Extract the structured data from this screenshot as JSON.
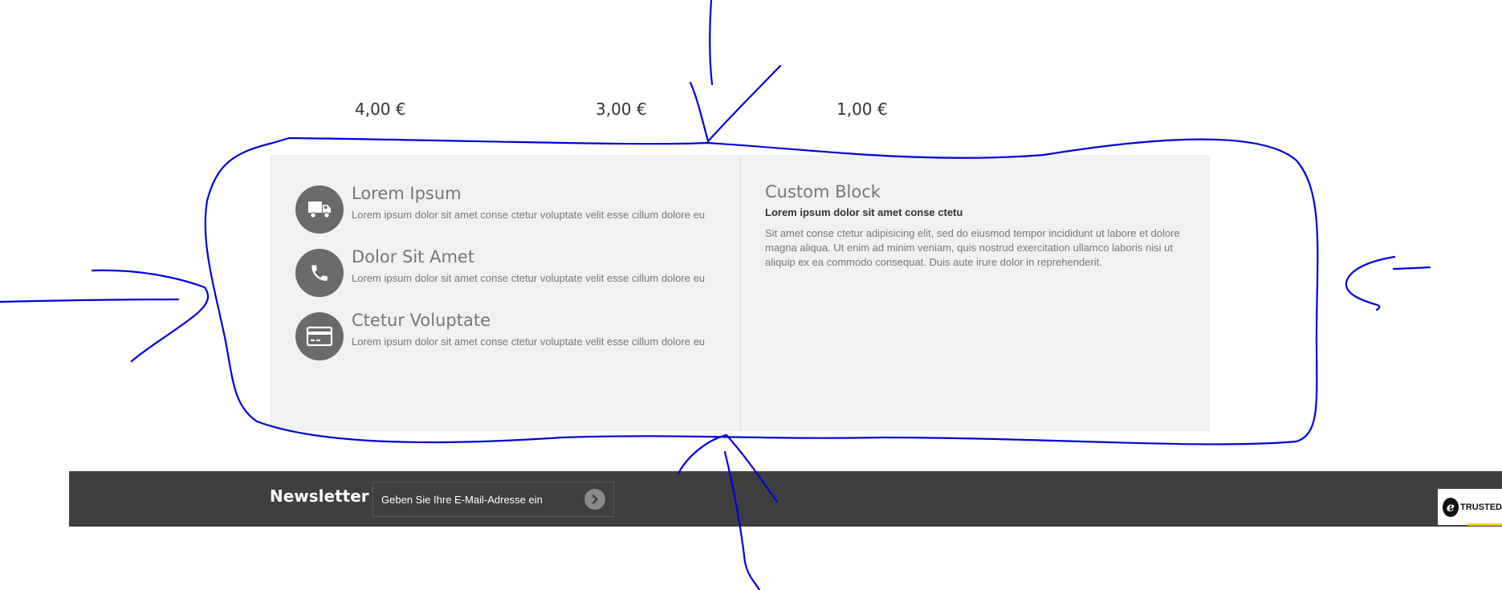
{
  "prices": [
    "4,00 €",
    "3,00 €",
    "1,00 €"
  ],
  "services": [
    {
      "title": "Lorem Ipsum",
      "text": "Lorem ipsum dolor sit amet conse ctetur voluptate velit esse cillum dolore eu",
      "icon": "truck-icon"
    },
    {
      "title": "Dolor Sit Amet",
      "text": "Lorem ipsum dolor sit amet conse ctetur voluptate velit esse cillum dolore eu",
      "icon": "phone-icon"
    },
    {
      "title": "Ctetur Voluptate",
      "text": "Lorem ipsum dolor sit amet conse ctetur voluptate velit esse cillum dolore eu",
      "icon": "credit-card-icon"
    }
  ],
  "custom_block": {
    "title": "Custom Block",
    "subtitle": "Lorem ipsum dolor sit amet conse ctetu",
    "text": "Sit amet conse ctetur adipisicing elit, sed do eiusmod tempor incididunt ut labore et dolore magna aliqua. Ut enim ad minim veniam, quis nostrud exercitation ullamco laboris nisi ut aliquip ex ea commodo consequat. Duis aute irure dolor in reprehenderit."
  },
  "newsletter": {
    "title": "Newsletter",
    "placeholder": "Geben Sie Ihre E-Mail-Adresse ein",
    "submit_icon": "chevron-right-circle-icon"
  },
  "trusted_badge": {
    "text": "TRUSTED",
    "logo_letter": "e"
  },
  "colors": {
    "panel_bg": "#f1f1f1",
    "icon_circle": "#6b6a6a",
    "newsletter_bg": "#3f3f3f",
    "annotation_stroke": "#0000dd",
    "trusted_accent": "#f5d000"
  }
}
